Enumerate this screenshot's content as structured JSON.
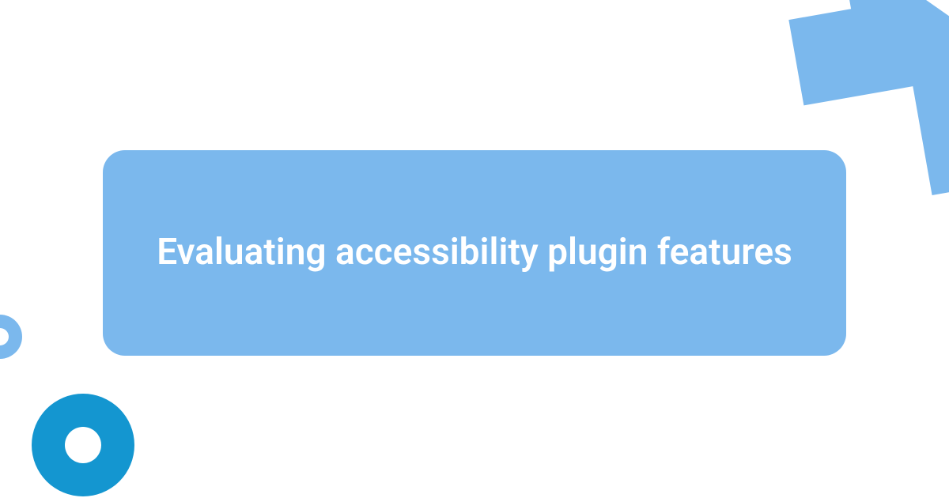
{
  "card": {
    "title": "Evaluating accessibility plugin features"
  },
  "colors": {
    "card_bg": "#7bb8ed",
    "accent_dark": "#1496d0",
    "text": "#ffffff"
  }
}
